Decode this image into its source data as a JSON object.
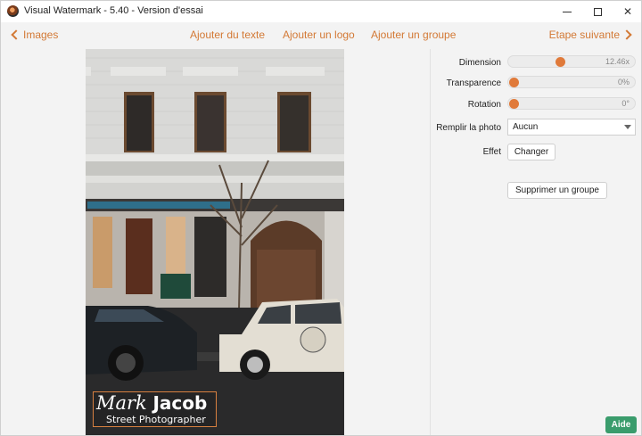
{
  "window": {
    "title": "Visual Watermark - 5.40 - Version d'essai"
  },
  "toolbar": {
    "back_label": "Images",
    "add_text_label": "Ajouter du texte",
    "add_logo_label": "Ajouter un logo",
    "add_group_label": "Ajouter un groupe",
    "next_label": "Etape suivante"
  },
  "panel": {
    "dimension": {
      "label": "Dimension",
      "value": "12.46x",
      "level": 0.4
    },
    "transparency": {
      "label": "Transparence",
      "value": "0%",
      "level": 0.0
    },
    "rotation": {
      "label": "Rotation",
      "value": "0°",
      "level": 0.0
    },
    "fill": {
      "label": "Remplir la photo",
      "selected": "Aucun"
    },
    "effect": {
      "label": "Effet",
      "button_label": "Changer"
    },
    "delete_group_label": "Supprimer un groupe"
  },
  "watermark": {
    "first_name": "Mark",
    "last_name": "Jacob",
    "subtitle": "Street Photographer"
  },
  "help_label": "Aide",
  "colors": {
    "accent": "#d37935",
    "slider_thumb": "#e07a3a",
    "help_button": "#3a9c6c"
  },
  "icons": {
    "app": "visual-watermark-app-icon",
    "back": "chevron-left-icon",
    "next": "chevron-right-icon"
  }
}
